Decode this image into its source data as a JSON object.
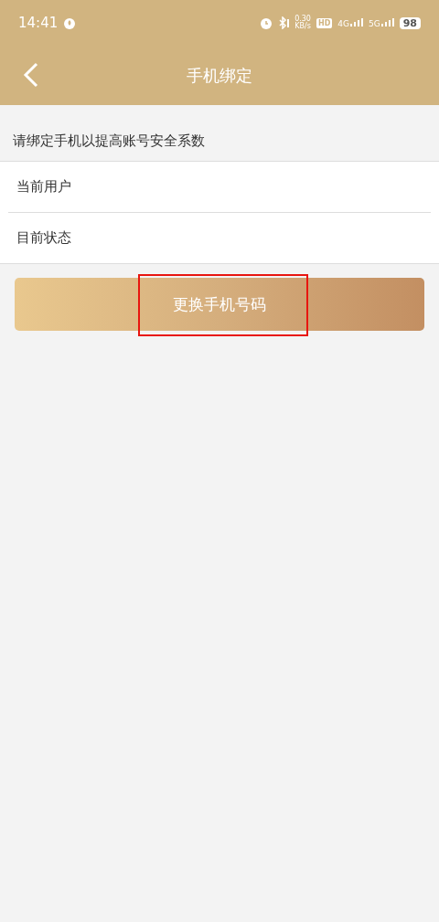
{
  "status_bar": {
    "time": "14:41",
    "speed": "0.30",
    "speed_unit": "KB/s",
    "hd": "HD",
    "sim1": "4G",
    "sim2": "5G",
    "battery": "98"
  },
  "nav": {
    "title": "手机绑定"
  },
  "prompt": "请绑定手机以提高账号安全系数",
  "rows": [
    {
      "label": "当前用户"
    },
    {
      "label": "目前状态"
    }
  ],
  "button": {
    "label": "更换手机号码",
    "highlighted": true
  }
}
